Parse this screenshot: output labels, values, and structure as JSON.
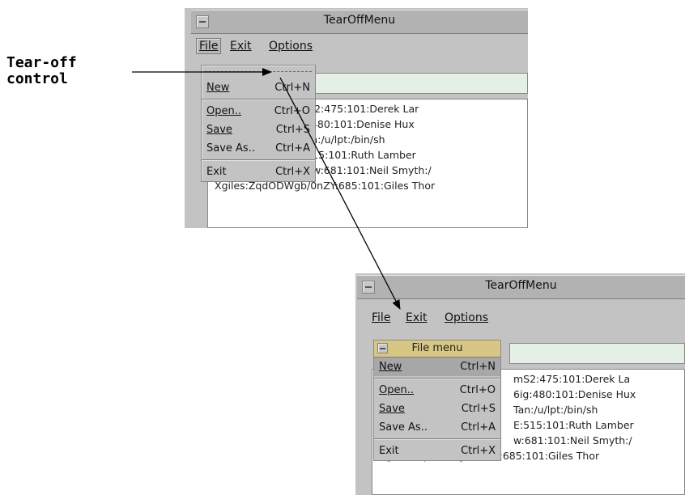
{
  "callout": {
    "line1": "Tear-off",
    "line2": "control"
  },
  "window_title": "TearOffMenu",
  "menu": {
    "file": "File",
    "exit": "Exit",
    "options": "Options"
  },
  "dropdown": {
    "items": [
      {
        "label": "New",
        "accel": "Ctrl+N"
      },
      {
        "label": "Open..",
        "accel": "Ctrl+O"
      },
      {
        "label": "Save",
        "accel": "Ctrl+S"
      },
      {
        "label": "Save As..",
        "accel": "Ctrl+A"
      },
      {
        "label": "Exit",
        "accel": "Ctrl+X"
      }
    ]
  },
  "torn_menu_title": "File menu",
  "text_lines_top": [
    ":MmS2:475:101:Derek Lar",
    "y6ig:480:101:Denise Hux",
    "ck Tan:/u/lpt:/bin/sh",
    ";0E:515:101:Ruth Lamber",
    "nas:Dp970XAt4gRLw:681:101:Neil Smyth:/",
    "Xgiles:ZqdODWgb/0nZY:685:101:Giles Thor"
  ],
  "text_lines_bottom": [
    "mS2:475:101:Derek La",
    "6ig:480:101:Denise Hux",
    "Tan:/u/lpt:/bin/sh",
    "E:515:101:Ruth Lamber",
    "w:681:101:Neil Smyth:/",
    "Xgiles:ZqdODWgb/0nZY:685:101:Giles Thor"
  ],
  "colors": {
    "window_bg": "#c3c3c3",
    "torn_title_bg": "#d8c784",
    "input_bg": "#e4f0e6"
  }
}
